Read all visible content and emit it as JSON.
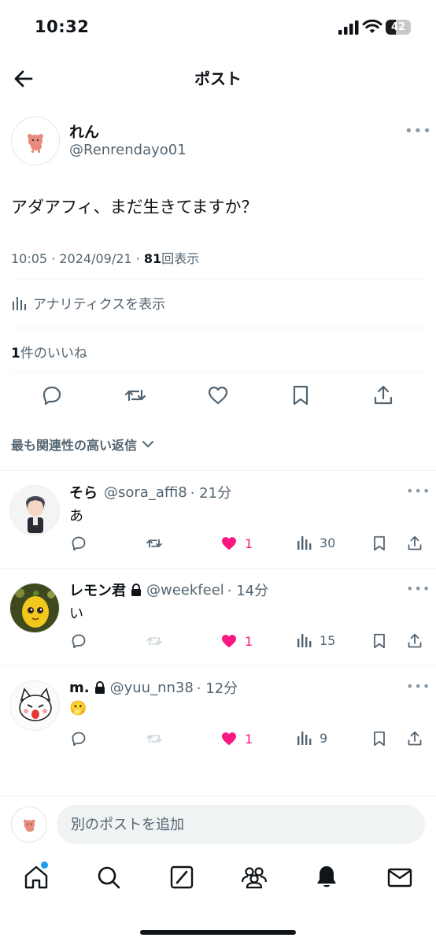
{
  "status_bar": {
    "time": "10:32",
    "battery": "42",
    "battery_level": 0.42
  },
  "header": {
    "title": "ポスト"
  },
  "post": {
    "display_name": "れん",
    "handle": "@Renrendayo01",
    "text": "アダアフィ、まだ生きてますか？",
    "time": "10:05 · 2024/09/21 · ",
    "views_count": "81",
    "views_label": "回表示",
    "analytics_label": "アナリティクスを表示",
    "likes_count": "1",
    "likes_label": "件のいいね"
  },
  "sort": {
    "label": "最も関連性の高い返信"
  },
  "replies": [
    {
      "name": "そら",
      "handle": "@sora_affi8",
      "time": "· 21分",
      "text": "あ",
      "likes": "1",
      "views": "30",
      "locked": false
    },
    {
      "name": "レモン君",
      "handle": "@weekfeel",
      "time": "· 14分",
      "text": "い",
      "likes": "1",
      "views": "15",
      "locked": true
    },
    {
      "name": "m.",
      "handle": "@yuu_nn38",
      "time": "· 12分",
      "text": "🫢",
      "likes": "1",
      "views": "9",
      "locked": true
    }
  ],
  "compose": {
    "placeholder": "別のポストを追加"
  },
  "colors": {
    "like": "#f91880",
    "accent": "#1d9bf0",
    "secondary": "#536471"
  },
  "tabs": [
    "home-icon",
    "search-icon",
    "grok-icon",
    "communities-icon",
    "notifications-icon",
    "messages-icon"
  ]
}
